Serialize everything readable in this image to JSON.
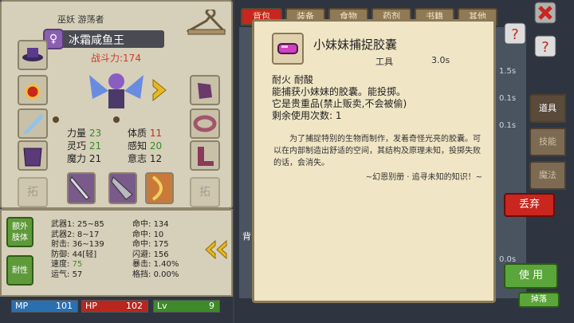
{
  "character": {
    "class_line": "巫妖 游荡者",
    "name": "冰霜咸鱼王",
    "power": "战斗力:174"
  },
  "stats": [
    {
      "label": "力量",
      "value": "23",
      "color": "green"
    },
    {
      "label": "体质",
      "value": "11",
      "color": "red"
    },
    {
      "label": "灵巧",
      "value": "21",
      "color": "green"
    },
    {
      "label": "感知",
      "value": "20",
      "color": "green"
    },
    {
      "label": "魔力",
      "value": "21",
      "color": "plain"
    },
    {
      "label": "意志",
      "value": "12",
      "color": "plain"
    }
  ],
  "slots": {
    "locked_a": "拓",
    "locked_b": "拓"
  },
  "side_buttons": {
    "extra_limbs": "额外\n肢体",
    "resistance": "耐性"
  },
  "combat": {
    "left": [
      {
        "label": "武器1:",
        "value": "25~85"
      },
      {
        "label": "武器2:",
        "value": "8~17"
      },
      {
        "label": "射击:",
        "value": "36~139"
      },
      {
        "label": "防御:",
        "value": "44[轻]"
      },
      {
        "label": "速度:",
        "value": "75"
      },
      {
        "label": "运气:",
        "value": "57"
      }
    ],
    "right": [
      {
        "label": "命中:",
        "value": "134"
      },
      {
        "label": "命中:",
        "value": "10"
      },
      {
        "label": "命中:",
        "value": "175"
      },
      {
        "label": "闪避:",
        "value": "156"
      },
      {
        "label": "暴击:",
        "value": "1.40%"
      },
      {
        "label": "格挡:",
        "value": "0.00%"
      }
    ]
  },
  "bars": {
    "mp_label": "MP",
    "mp_value": "101",
    "hp_label": "HP",
    "hp_value": "102",
    "lv_label": "Lv",
    "lv_value": "9"
  },
  "tabs": [
    "背包",
    "装备",
    "食物",
    "药剂",
    "书籍",
    "其他"
  ],
  "right_tabs": [
    "道具",
    "技能",
    "魔法"
  ],
  "item": {
    "title": "小妹妹捕捉胶囊",
    "type": "工具",
    "weight": "3.0s",
    "props": [
      "耐火 耐酸",
      "能捕获小妹妹的胶囊。能投掷。",
      "它是贵重品(禁止贩卖,不会被偷)",
      "剩余使用次数: 1"
    ],
    "description": "为了捕捉特别的生物而制作，发着奇怪光亮的胶囊。可以在内部制造出舒适的空间，其结构及原理未知，投掷失败的话，会消失。",
    "signature": "~幻恩别册 · 追寻未知的知识！~"
  },
  "buttons": {
    "discard": "丢弃",
    "use": "使 用",
    "partial_bottom": "掉落"
  },
  "bg_fragments": {
    "bag_label": "背",
    "weights": [
      "1.5s",
      "0.1s",
      "0.1s",
      "0.0s"
    ]
  },
  "colors": {
    "accent_red": "#c8261e",
    "accent_green": "#5aa63a",
    "power_red": "#d03b2a",
    "mp_blue": "#2a6fb0",
    "hp_red": "#b8261e",
    "lv_green": "#3d8a2a"
  }
}
